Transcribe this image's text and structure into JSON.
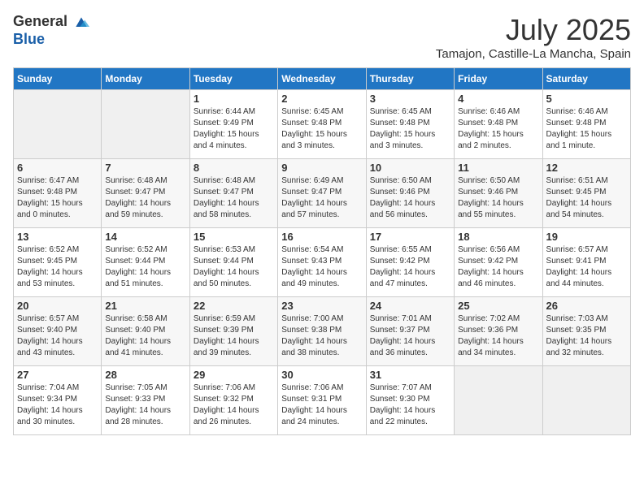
{
  "header": {
    "logo_general": "General",
    "logo_blue": "Blue",
    "month": "July 2025",
    "location": "Tamajon, Castille-La Mancha, Spain"
  },
  "weekdays": [
    "Sunday",
    "Monday",
    "Tuesday",
    "Wednesday",
    "Thursday",
    "Friday",
    "Saturday"
  ],
  "weeks": [
    [
      {
        "day": "",
        "empty": true
      },
      {
        "day": "",
        "empty": true
      },
      {
        "day": "1",
        "sunrise": "6:44 AM",
        "sunset": "9:49 PM",
        "daylight": "15 hours and 4 minutes."
      },
      {
        "day": "2",
        "sunrise": "6:45 AM",
        "sunset": "9:48 PM",
        "daylight": "15 hours and 3 minutes."
      },
      {
        "day": "3",
        "sunrise": "6:45 AM",
        "sunset": "9:48 PM",
        "daylight": "15 hours and 3 minutes."
      },
      {
        "day": "4",
        "sunrise": "6:46 AM",
        "sunset": "9:48 PM",
        "daylight": "15 hours and 2 minutes."
      },
      {
        "day": "5",
        "sunrise": "6:46 AM",
        "sunset": "9:48 PM",
        "daylight": "15 hours and 1 minute."
      }
    ],
    [
      {
        "day": "6",
        "sunrise": "6:47 AM",
        "sunset": "9:48 PM",
        "daylight": "15 hours and 0 minutes."
      },
      {
        "day": "7",
        "sunrise": "6:48 AM",
        "sunset": "9:47 PM",
        "daylight": "14 hours and 59 minutes."
      },
      {
        "day": "8",
        "sunrise": "6:48 AM",
        "sunset": "9:47 PM",
        "daylight": "14 hours and 58 minutes."
      },
      {
        "day": "9",
        "sunrise": "6:49 AM",
        "sunset": "9:47 PM",
        "daylight": "14 hours and 57 minutes."
      },
      {
        "day": "10",
        "sunrise": "6:50 AM",
        "sunset": "9:46 PM",
        "daylight": "14 hours and 56 minutes."
      },
      {
        "day": "11",
        "sunrise": "6:50 AM",
        "sunset": "9:46 PM",
        "daylight": "14 hours and 55 minutes."
      },
      {
        "day": "12",
        "sunrise": "6:51 AM",
        "sunset": "9:45 PM",
        "daylight": "14 hours and 54 minutes."
      }
    ],
    [
      {
        "day": "13",
        "sunrise": "6:52 AM",
        "sunset": "9:45 PM",
        "daylight": "14 hours and 53 minutes."
      },
      {
        "day": "14",
        "sunrise": "6:52 AM",
        "sunset": "9:44 PM",
        "daylight": "14 hours and 51 minutes."
      },
      {
        "day": "15",
        "sunrise": "6:53 AM",
        "sunset": "9:44 PM",
        "daylight": "14 hours and 50 minutes."
      },
      {
        "day": "16",
        "sunrise": "6:54 AM",
        "sunset": "9:43 PM",
        "daylight": "14 hours and 49 minutes."
      },
      {
        "day": "17",
        "sunrise": "6:55 AM",
        "sunset": "9:42 PM",
        "daylight": "14 hours and 47 minutes."
      },
      {
        "day": "18",
        "sunrise": "6:56 AM",
        "sunset": "9:42 PM",
        "daylight": "14 hours and 46 minutes."
      },
      {
        "day": "19",
        "sunrise": "6:57 AM",
        "sunset": "9:41 PM",
        "daylight": "14 hours and 44 minutes."
      }
    ],
    [
      {
        "day": "20",
        "sunrise": "6:57 AM",
        "sunset": "9:40 PM",
        "daylight": "14 hours and 43 minutes."
      },
      {
        "day": "21",
        "sunrise": "6:58 AM",
        "sunset": "9:40 PM",
        "daylight": "14 hours and 41 minutes."
      },
      {
        "day": "22",
        "sunrise": "6:59 AM",
        "sunset": "9:39 PM",
        "daylight": "14 hours and 39 minutes."
      },
      {
        "day": "23",
        "sunrise": "7:00 AM",
        "sunset": "9:38 PM",
        "daylight": "14 hours and 38 minutes."
      },
      {
        "day": "24",
        "sunrise": "7:01 AM",
        "sunset": "9:37 PM",
        "daylight": "14 hours and 36 minutes."
      },
      {
        "day": "25",
        "sunrise": "7:02 AM",
        "sunset": "9:36 PM",
        "daylight": "14 hours and 34 minutes."
      },
      {
        "day": "26",
        "sunrise": "7:03 AM",
        "sunset": "9:35 PM",
        "daylight": "14 hours and 32 minutes."
      }
    ],
    [
      {
        "day": "27",
        "sunrise": "7:04 AM",
        "sunset": "9:34 PM",
        "daylight": "14 hours and 30 minutes."
      },
      {
        "day": "28",
        "sunrise": "7:05 AM",
        "sunset": "9:33 PM",
        "daylight": "14 hours and 28 minutes."
      },
      {
        "day": "29",
        "sunrise": "7:06 AM",
        "sunset": "9:32 PM",
        "daylight": "14 hours and 26 minutes."
      },
      {
        "day": "30",
        "sunrise": "7:06 AM",
        "sunset": "9:31 PM",
        "daylight": "14 hours and 24 minutes."
      },
      {
        "day": "31",
        "sunrise": "7:07 AM",
        "sunset": "9:30 PM",
        "daylight": "14 hours and 22 minutes."
      },
      {
        "day": "",
        "empty": true
      },
      {
        "day": "",
        "empty": true
      }
    ]
  ]
}
